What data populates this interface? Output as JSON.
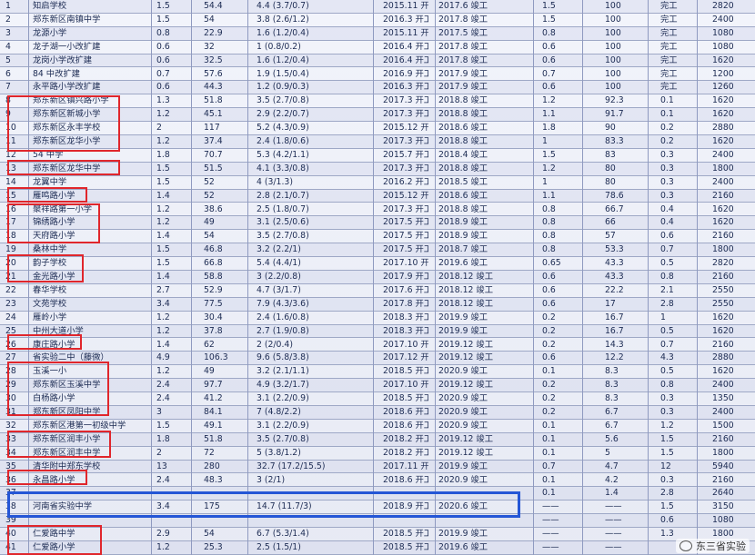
{
  "rows": [
    {
      "no": "1",
      "name": "知启学校",
      "a": "1.5",
      "b": "54.4",
      "c": "4.4 (3.7/0.7)",
      "start": "2015.11 开工",
      "end": "2017.6 竣工",
      "d": "1.5",
      "e": "100",
      "status": "完工",
      "f": "2820"
    },
    {
      "no": "2",
      "name": "郑东新区南镇中学",
      "a": "1.5",
      "b": "54",
      "c": "3.8 (2.6/1.2)",
      "start": "2016.3 开工",
      "end": "2017.8 竣工",
      "d": "1.5",
      "e": "100",
      "status": "完工",
      "f": "2400"
    },
    {
      "no": "3",
      "name": "龙源小学",
      "a": "0.8",
      "b": "22.9",
      "c": "1.6 (1.2/0.4)",
      "start": "2015.11 开工",
      "end": "2017.5 竣工",
      "d": "0.8",
      "e": "100",
      "status": "完工",
      "f": "1080"
    },
    {
      "no": "4",
      "name": "龙子湖一小改扩建",
      "a": "0.6",
      "b": "32",
      "c": "1 (0.8/0.2)",
      "start": "2016.4 开工",
      "end": "2017.8 竣工",
      "d": "0.6",
      "e": "100",
      "status": "完工",
      "f": "1080"
    },
    {
      "no": "5",
      "name": "龙岗小学改扩建",
      "a": "0.6",
      "b": "32.5",
      "c": "1.6 (1.2/0.4)",
      "start": "2016.4 开工",
      "end": "2017.8 竣工",
      "d": "0.6",
      "e": "100",
      "status": "完工",
      "f": "1620"
    },
    {
      "no": "6",
      "name": "84 中改扩建",
      "a": "0.7",
      "b": "57.6",
      "c": "1.9 (1.5/0.4)",
      "start": "2016.9 开工",
      "end": "2017.9 竣工",
      "d": "0.7",
      "e": "100",
      "status": "完工",
      "f": "1200"
    },
    {
      "no": "7",
      "name": "永平路小学改扩建",
      "a": "0.6",
      "b": "44.3",
      "c": "1.2 (0.9/0.3)",
      "start": "2016.3 开工",
      "end": "2017.9 竣工",
      "d": "0.6",
      "e": "100",
      "status": "完工",
      "f": "1260"
    },
    {
      "no": "8",
      "name": "郑东新区镇兴路小学",
      "a": "1.3",
      "b": "51.8",
      "c": "3.5 (2.7/0.8)",
      "start": "2017.3 开工",
      "end": "2018.8 竣工",
      "d": "1.2",
      "e": "92.3",
      "status": "0.1",
      "f": "1620"
    },
    {
      "no": "9",
      "name": "郑东新区新城小学",
      "a": "1.2",
      "b": "45.1",
      "c": "2.9 (2.2/0.7)",
      "start": "2017.3 开工",
      "end": "2018.8 竣工",
      "d": "1.1",
      "e": "91.7",
      "status": "0.1",
      "f": "1620"
    },
    {
      "no": "10",
      "name": "郑东新区永丰学校",
      "a": "2",
      "b": "117",
      "c": "5.2 (4.3/0.9)",
      "start": "2015.12 开工",
      "end": "2018.6 竣工",
      "d": "1.8",
      "e": "90",
      "status": "0.2",
      "f": "2880"
    },
    {
      "no": "11",
      "name": "郑东新区龙华小学",
      "a": "1.2",
      "b": "37.4",
      "c": "2.4 (1.8/0.6)",
      "start": "2017.3 开工",
      "end": "2018.8 竣工",
      "d": "1",
      "e": "83.3",
      "status": "0.2",
      "f": "1620"
    },
    {
      "no": "12",
      "name": "54 中学",
      "a": "1.8",
      "b": "70.7",
      "c": "5.3 (4.2/1.1)",
      "start": "2015.7 开工",
      "end": "2018.4 竣工",
      "d": "1.5",
      "e": "83",
      "status": "0.3",
      "f": "2400"
    },
    {
      "no": "13",
      "name": "郑东新区龙华中学",
      "a": "1.5",
      "b": "51.5",
      "c": "4.1 (3.3/0.8)",
      "start": "2017.3 开工",
      "end": "2018.8 竣工",
      "d": "1.2",
      "e": "80",
      "status": "0.3",
      "f": "1800"
    },
    {
      "no": "14",
      "name": "龙翼中学",
      "a": "1.5",
      "b": "52",
      "c": "4 (3/1.3)",
      "start": "2016.2 开工",
      "end": "2018.5 竣工",
      "d": "1",
      "e": "80",
      "status": "0.3",
      "f": "2400"
    },
    {
      "no": "15",
      "name": "雁鸣路小学",
      "a": "1.4",
      "b": "52",
      "c": "2.8 (2.1/0.7)",
      "start": "2015.12 开工",
      "end": "2018.6 竣工",
      "d": "1.1",
      "e": "78.6",
      "status": "0.3",
      "f": "2160"
    },
    {
      "no": "16",
      "name": "聚祥路第一小学",
      "a": "1.2",
      "b": "38.6",
      "c": "2.5 (1.8/0.7)",
      "start": "2017.3 开工",
      "end": "2018.8 竣工",
      "d": "0.8",
      "e": "66.7",
      "status": "0.4",
      "f": "1620"
    },
    {
      "no": "17",
      "name": "锦绣路小学",
      "a": "1.2",
      "b": "49",
      "c": "3.1 (2.5/0.6)",
      "start": "2017.5 开工",
      "end": "2018.9 竣工",
      "d": "0.8",
      "e": "66",
      "status": "0.4",
      "f": "1620"
    },
    {
      "no": "18",
      "name": "天府路小学",
      "a": "1.4",
      "b": "54",
      "c": "3.5 (2.7/0.8)",
      "start": "2017.5 开工",
      "end": "2018.9 竣工",
      "d": "0.8",
      "e": "57",
      "status": "0.6",
      "f": "2160"
    },
    {
      "no": "19",
      "name": "桑林中学",
      "a": "1.5",
      "b": "46.8",
      "c": "3.2 (2.2/1)",
      "start": "2017.5 开工",
      "end": "2018.7 竣工",
      "d": "0.8",
      "e": "53.3",
      "status": "0.7",
      "f": "1800"
    },
    {
      "no": "20",
      "name": "韵子学校",
      "a": "1.5",
      "b": "66.8",
      "c": "5.4 (4.4/1)",
      "start": "2017.10 开工",
      "end": "2019.6 竣工",
      "d": "0.65",
      "e": "43.3",
      "status": "0.5",
      "f": "2820"
    },
    {
      "no": "21",
      "name": "金光路小学",
      "a": "1.4",
      "b": "58.8",
      "c": "3 (2.2/0.8)",
      "start": "2017.9 开工",
      "end": "2018.12 竣工",
      "d": "0.6",
      "e": "43.3",
      "status": "0.8",
      "f": "2160"
    },
    {
      "no": "22",
      "name": "春华学校",
      "a": "2.7",
      "b": "52.9",
      "c": "4.7 (3/1.7)",
      "start": "2017.6 开工",
      "end": "2018.12 竣工",
      "d": "0.6",
      "e": "22.2",
      "status": "2.1",
      "f": "2550"
    },
    {
      "no": "23",
      "name": "文苑学校",
      "a": "3.4",
      "b": "77.5",
      "c": "7.9 (4.3/3.6)",
      "start": "2017.8 开工",
      "end": "2018.12 竣工",
      "d": "0.6",
      "e": "17",
      "status": "2.8",
      "f": "2550"
    },
    {
      "no": "24",
      "name": "雁岭小学",
      "a": "1.2",
      "b": "30.4",
      "c": "2.4 (1.6/0.8)",
      "start": "2018.3 开工",
      "end": "2019.9 竣工",
      "d": "0.2",
      "e": "16.7",
      "status": "1",
      "f": "1620"
    },
    {
      "no": "25",
      "name": "中州大道小学",
      "a": "1.2",
      "b": "37.8",
      "c": "2.7 (1.9/0.8)",
      "start": "2018.3 开工",
      "end": "2019.9 竣工",
      "d": "0.2",
      "e": "16.7",
      "status": "0.5",
      "f": "1620"
    },
    {
      "no": "26",
      "name": "康庄路小学",
      "a": "1.4",
      "b": "62",
      "c": "2 (2/0.4)",
      "start": "2017.10 开工",
      "end": "2019.12 竣工",
      "d": "0.2",
      "e": "14.3",
      "status": "0.7",
      "f": "2160"
    },
    {
      "no": "27",
      "name": "省实验二中（藤微）",
      "a": "4.9",
      "b": "106.3",
      "c": "9.6 (5.8/3.8)",
      "start": "2017.12 开工",
      "end": "2019.12 竣工",
      "d": "0.6",
      "e": "12.2",
      "status": "4.3",
      "f": "2880"
    },
    {
      "no": "28",
      "name": "玉溪一小",
      "a": "1.2",
      "b": "49",
      "c": "3.2 (2.1/1.1)",
      "start": "2018.5 开工",
      "end": "2020.9 竣工",
      "d": "0.1",
      "e": "8.3",
      "status": "0.5",
      "f": "1620"
    },
    {
      "no": "29",
      "name": "郑东新区玉溪中学",
      "a": "2.4",
      "b": "97.7",
      "c": "4.9 (3.2/1.7)",
      "start": "2017.10 开工",
      "end": "2019.12 竣工",
      "d": "0.2",
      "e": "8.3",
      "status": "0.8",
      "f": "2400"
    },
    {
      "no": "30",
      "name": "白杨路小学",
      "a": "2.4",
      "b": "41.2",
      "c": "3.1 (2.2/0.9)",
      "start": "2018.5 开工",
      "end": "2020.9 竣工",
      "d": "0.2",
      "e": "8.3",
      "status": "0.3",
      "f": "1350"
    },
    {
      "no": "31",
      "name": "郑东新区凤阳中学",
      "a": "3",
      "b": "84.1",
      "c": "7 (4.8/2.2)",
      "start": "2018.6 开工",
      "end": "2020.9 竣工",
      "d": "0.2",
      "e": "6.7",
      "status": "0.3",
      "f": "2400"
    },
    {
      "no": "32",
      "name": "郑东新区港第一初级中学",
      "a": "1.5",
      "b": "49.1",
      "c": "3.1 (2.2/0.9)",
      "start": "2018.6 开工",
      "end": "2020.9 竣工",
      "d": "0.1",
      "e": "6.7",
      "status": "1.2",
      "f": "1500"
    },
    {
      "no": "33",
      "name": "郑东新区润丰小学",
      "a": "1.8",
      "b": "51.8",
      "c": "3.5 (2.7/0.8)",
      "start": "2018.2 开工",
      "end": "2019.12 竣工",
      "d": "0.1",
      "e": "5.6",
      "status": "1.5",
      "f": "2160"
    },
    {
      "no": "34",
      "name": "郑东新区润丰中学",
      "a": "2",
      "b": "72",
      "c": "5 (3.8/1.2)",
      "start": "2018.2 开工",
      "end": "2019.12 竣工",
      "d": "0.1",
      "e": "5",
      "status": "1.5",
      "f": "1800"
    },
    {
      "no": "35",
      "name": "清华附中郑东学校",
      "a": "13",
      "b": "280",
      "c": "32.7 (17.2/15.5)",
      "start": "2017.11 开工",
      "end": "2019.9 竣工",
      "d": "0.7",
      "e": "4.7",
      "status": "12",
      "f": "5940"
    },
    {
      "no": "36",
      "name": "永昌路小学",
      "a": "2.4",
      "b": "48.3",
      "c": "3 (2/1)",
      "start": "2018.6 开工",
      "end": "2020.9 竣工",
      "d": "0.1",
      "e": "4.2",
      "status": "0.3",
      "f": "2160"
    },
    {
      "no": "37",
      "name": "",
      "a": "",
      "b": "",
      "c": "",
      "start": "",
      "end": "",
      "d": "0.1",
      "e": "1.4",
      "status": "2.8",
      "f": "2640"
    },
    {
      "no": "38",
      "name": "河南省实验中学",
      "a": "3.4",
      "b": "175",
      "c": "14.7 (11.7/3)",
      "start": "2018.9 开工",
      "end": "2020.6 竣工",
      "d": "——",
      "e": "——",
      "status": "1.5",
      "f": "3150"
    },
    {
      "no": "39",
      "name": "",
      "a": "",
      "b": "",
      "c": "",
      "start": "",
      "end": "",
      "d": "——",
      "e": "——",
      "status": "0.6",
      "f": "1080"
    },
    {
      "no": "40",
      "name": "仁爱路中学",
      "a": "2.9",
      "b": "54",
      "c": "6.7 (5.3/1.4)",
      "start": "2018.5 开工",
      "end": "2019.9 竣工",
      "d": "——",
      "e": "——",
      "status": "1.3",
      "f": "1800"
    },
    {
      "no": "41",
      "name": "仁爱路小学",
      "a": "1.2",
      "b": "25.3",
      "c": "2.5 (1.5/1)",
      "start": "2018.5 开工",
      "end": "2019.6 竣工",
      "d": "——",
      "e": "——",
      "status": "",
      "f": ""
    }
  ],
  "watermark": "东三省实验",
  "colors": {
    "highlight_red": "#e0262c",
    "highlight_blue": "#2456d6"
  }
}
